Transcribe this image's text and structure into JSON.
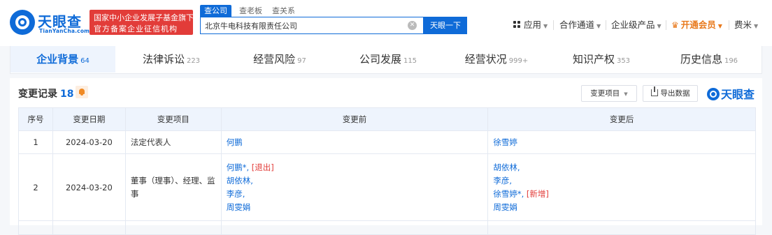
{
  "brand": {
    "name": "天眼查",
    "name_en": "TianYanCha.com",
    "badge_line1": "国家中小企业发展子基金旗下",
    "badge_line2": "官方备案企业征信机构"
  },
  "search": {
    "tabs": [
      "查公司",
      "查老板",
      "查关系"
    ],
    "active_tab": "查公司",
    "value": "北京牛电科技有限责任公司",
    "button_label": "天眼一下"
  },
  "topnav": {
    "apps": "应用",
    "partners": "合作通道",
    "enterprise": "企业级产品",
    "vip": "开通会员",
    "user": "费米"
  },
  "tabs": [
    {
      "label": "企业背景",
      "count": "64"
    },
    {
      "label": "法律诉讼",
      "count": "223"
    },
    {
      "label": "经营风险",
      "count": "97"
    },
    {
      "label": "公司发展",
      "count": "115"
    },
    {
      "label": "经营状况",
      "count": "999+"
    },
    {
      "label": "知识产权",
      "count": "353"
    },
    {
      "label": "历史信息",
      "count": "196"
    }
  ],
  "section": {
    "title": "变更记录",
    "count": "18",
    "filter_label": "变更项目",
    "export_label": "导出数据",
    "watermark": "天眼查"
  },
  "table": {
    "headers": [
      "序号",
      "变更日期",
      "变更项目",
      "变更前",
      "变更后"
    ],
    "rows": [
      {
        "seq": "1",
        "date": "2024-03-20",
        "item": "法定代表人",
        "before": [
          {
            "name": "何鹏",
            "tag": ""
          }
        ],
        "after": [
          {
            "name": "徐雪婷",
            "tag": ""
          }
        ]
      },
      {
        "seq": "2",
        "date": "2024-03-20",
        "item": "董事（理事）、经理、监事",
        "before": [
          {
            "name": "何鹏*,",
            "tag": "[退出]"
          },
          {
            "name": "胡依林,",
            "tag": ""
          },
          {
            "name": "李彦,",
            "tag": ""
          },
          {
            "name": "周雯娟",
            "tag": ""
          }
        ],
        "after": [
          {
            "name": "胡依林,",
            "tag": ""
          },
          {
            "name": "李彦,",
            "tag": ""
          },
          {
            "name": "徐雪婷*,",
            "tag": "[新增]"
          },
          {
            "name": "周雯娟",
            "tag": ""
          }
        ]
      }
    ]
  },
  "colors": {
    "brand_blue": "#0f6bd8",
    "badge_red": "#e23c39",
    "vip_orange": "#e8791c"
  }
}
